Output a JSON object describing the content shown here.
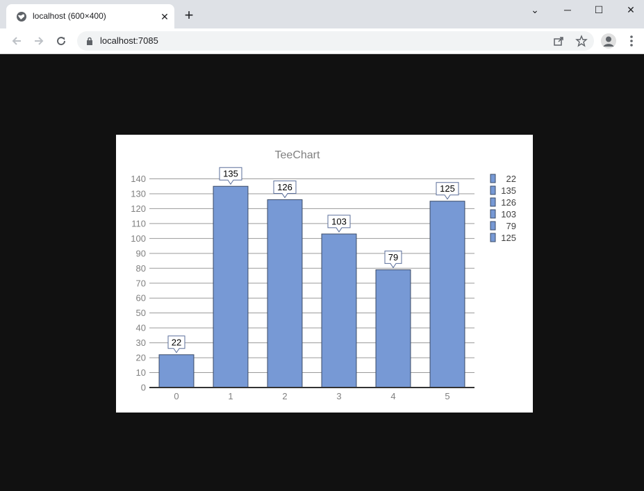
{
  "browser": {
    "tab_title": "localhost (600×400)",
    "tab_close": "✕",
    "new_tab": "+",
    "url": "localhost:7085",
    "window_controls": {
      "dropdown": "⌄",
      "minimize": "─",
      "maximize": "☐",
      "close": "✕"
    },
    "icons": {
      "back": "arrow-left-icon",
      "forward": "arrow-right-icon",
      "reload": "reload-icon",
      "lock": "lock-icon",
      "share": "share-icon",
      "bookmark": "star-icon",
      "profile": "avatar-icon",
      "menu": "kebab-menu-icon"
    }
  },
  "chart_data": {
    "type": "bar",
    "title": "TeeChart",
    "categories": [
      "0",
      "1",
      "2",
      "3",
      "4",
      "5"
    ],
    "values": [
      22,
      135,
      126,
      103,
      79,
      125
    ],
    "data_labels": [
      "22",
      "135",
      "126",
      "103",
      "79",
      "125"
    ],
    "legend": [
      "22",
      "135",
      "126",
      "103",
      "79",
      "125"
    ],
    "legend_position": "right",
    "ylim": [
      0,
      140
    ],
    "yticks": [
      0,
      10,
      20,
      30,
      40,
      50,
      60,
      70,
      80,
      90,
      100,
      110,
      120,
      130,
      140
    ],
    "grid": true,
    "xlabel": "",
    "ylabel": "",
    "colors": {
      "bar": "#7799d5",
      "bar_stroke": "#3a4a66",
      "grid": "#9a9a9a",
      "axis": "#333333",
      "tick_text": "#808080",
      "title": "#808080"
    }
  }
}
